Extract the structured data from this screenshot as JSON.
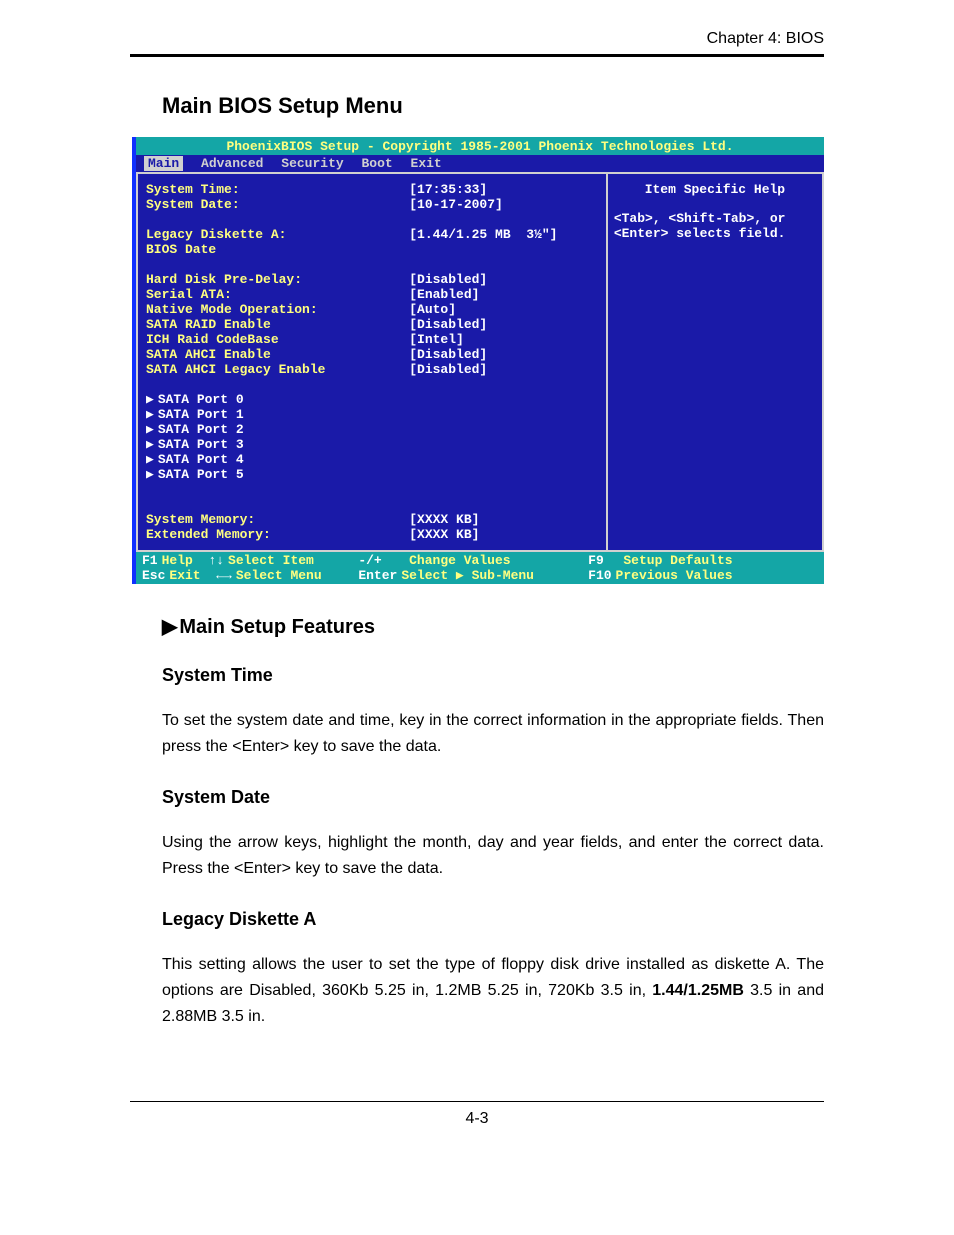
{
  "chapter": "Chapter 4: BIOS",
  "section_title": "Main BIOS Setup Menu",
  "bios": {
    "titlebar": "PhoenixBIOS Setup - Copyright 1985-2001 Phoenix Technologies Ltd.",
    "menu": {
      "items": [
        "Main",
        "Advanced",
        "Security",
        "Boot",
        "Exit"
      ],
      "active": "Main"
    },
    "settings": [
      {
        "label": "System Time:",
        "value": "[17:35:33]"
      },
      {
        "label": "System Date:",
        "value": "[10-17-2007]"
      }
    ],
    "settings2": [
      {
        "label": "Legacy Diskette A:",
        "value": "[1.44/1.25 MB  3½\"]"
      },
      {
        "label": "BIOS Date",
        "value": ""
      }
    ],
    "settings3": [
      {
        "label": "Hard Disk Pre-Delay:",
        "value": "[Disabled]"
      },
      {
        "label": "Serial ATA:",
        "value": "[Enabled]"
      },
      {
        "label": "Native Mode Operation:",
        "value": "[Auto]"
      },
      {
        "label": "SATA RAID Enable",
        "value": "[Disabled]"
      },
      {
        "label": "ICH Raid CodeBase",
        "value": "[Intel]"
      },
      {
        "label": "SATA AHCI Enable",
        "value": "[Disabled]"
      },
      {
        "label": "SATA AHCI Legacy Enable",
        "value": "[Disabled]"
      }
    ],
    "submenus": [
      "SATA Port 0",
      "SATA Port 1",
      "SATA Port 2",
      "SATA Port 3",
      "SATA Port 4",
      "SATA Port 5"
    ],
    "memory": [
      {
        "label": "System Memory:",
        "value": "[XXXX KB]"
      },
      {
        "label": "Extended Memory:",
        "value": "[XXXX KB]"
      }
    ],
    "help": {
      "title": "Item Specific Help",
      "text": "<Tab>, <Shift-Tab>, or\n<Enter> selects field."
    },
    "footer": {
      "r1": [
        {
          "k": "F1",
          "d": "Help"
        },
        {
          "k": "↑↓",
          "d": "Select Item"
        },
        {
          "k": "-/+",
          "d": "Change Values"
        },
        {
          "k": "F9",
          "d": "Setup Defaults"
        }
      ],
      "r2": [
        {
          "k": "Esc",
          "d": "Exit"
        },
        {
          "k": "←→",
          "d": "Select Menu"
        },
        {
          "k": "Enter",
          "d": "Select ▶ Sub-Menu"
        },
        {
          "k": "F10",
          "d": "Previous Values"
        }
      ]
    }
  },
  "features": {
    "heading": "Main Setup Features",
    "items": [
      {
        "title": "System Time",
        "body": "To set the system date and time, key in the correct information in the appropriate fields. Then press the <Enter> key to save the data."
      },
      {
        "title": "System Date",
        "body": "Using the arrow keys, highlight the month, day and year fields, and enter the correct data. Press the <Enter> key to save the data."
      },
      {
        "title": "Legacy Diskette A",
        "body_pre": "This setting allows the user to set the type of floppy disk drive installed as diskette A. The options are Disabled, 360Kb 5.25 in, 1.2MB 5.25 in, 720Kb 3.5 in, ",
        "body_bold": "1.44/1.25MB",
        "body_post": " 3.5 in and 2.88MB 3.5 in."
      }
    ]
  },
  "page_number": "4-3"
}
